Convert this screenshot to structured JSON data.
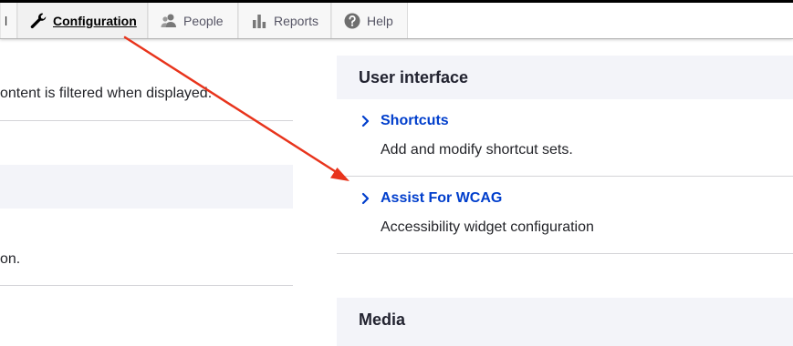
{
  "toolbar": {
    "partial_label": "l",
    "items": [
      {
        "label": "Configuration",
        "icon": "wrench-icon",
        "active": true
      },
      {
        "label": "People",
        "icon": "people-icon"
      },
      {
        "label": "Reports",
        "icon": "bar-chart-icon"
      },
      {
        "label": "Help",
        "icon": "help-icon"
      }
    ]
  },
  "left": {
    "text1": "ontent is filtered when displayed.",
    "text2": "on."
  },
  "right": {
    "user_interface": {
      "heading": "User interface",
      "items": [
        {
          "title": "Shortcuts",
          "description": "Add and modify shortcut sets."
        },
        {
          "title": "Assist For WCAG",
          "description": "Accessibility widget configuration"
        }
      ]
    },
    "media": {
      "heading": "Media"
    }
  },
  "colors": {
    "link": "#003ecc",
    "annotation_arrow": "#e8341c",
    "panel_bg": "#f3f4f9"
  }
}
